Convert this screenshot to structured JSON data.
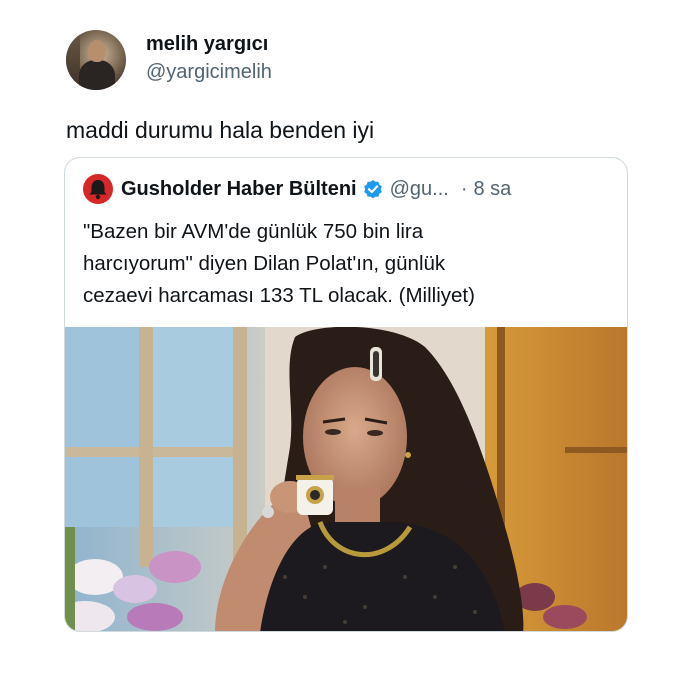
{
  "author": {
    "display_name": "melih yargıcı",
    "handle": "@yargicimelih"
  },
  "tweet": {
    "text": "maddi durumu hala benden iyi"
  },
  "quoted_tweet": {
    "display_name": "Gusholder Haber Bülteni",
    "handle": "@gu...",
    "separator": "·",
    "time": "8 sa",
    "verified": true,
    "text_lines": [
      "\"Bazen bir AVM'de günlük 750 bin lira",
      "harcıyorum\" diyen Dilan Polat'ın, günlük",
      "cezaevi harcaması 133 TL olacak. (Milliyet)"
    ]
  },
  "colors": {
    "text_primary": "#0f1419",
    "text_secondary": "#536471",
    "border": "#cfd9de",
    "verified_blue": "#1d9bf0",
    "news_avatar_red": "#d62828"
  },
  "icons": {
    "verified": "verified-badge-icon",
    "news_avatar": "bell-logo-icon"
  }
}
